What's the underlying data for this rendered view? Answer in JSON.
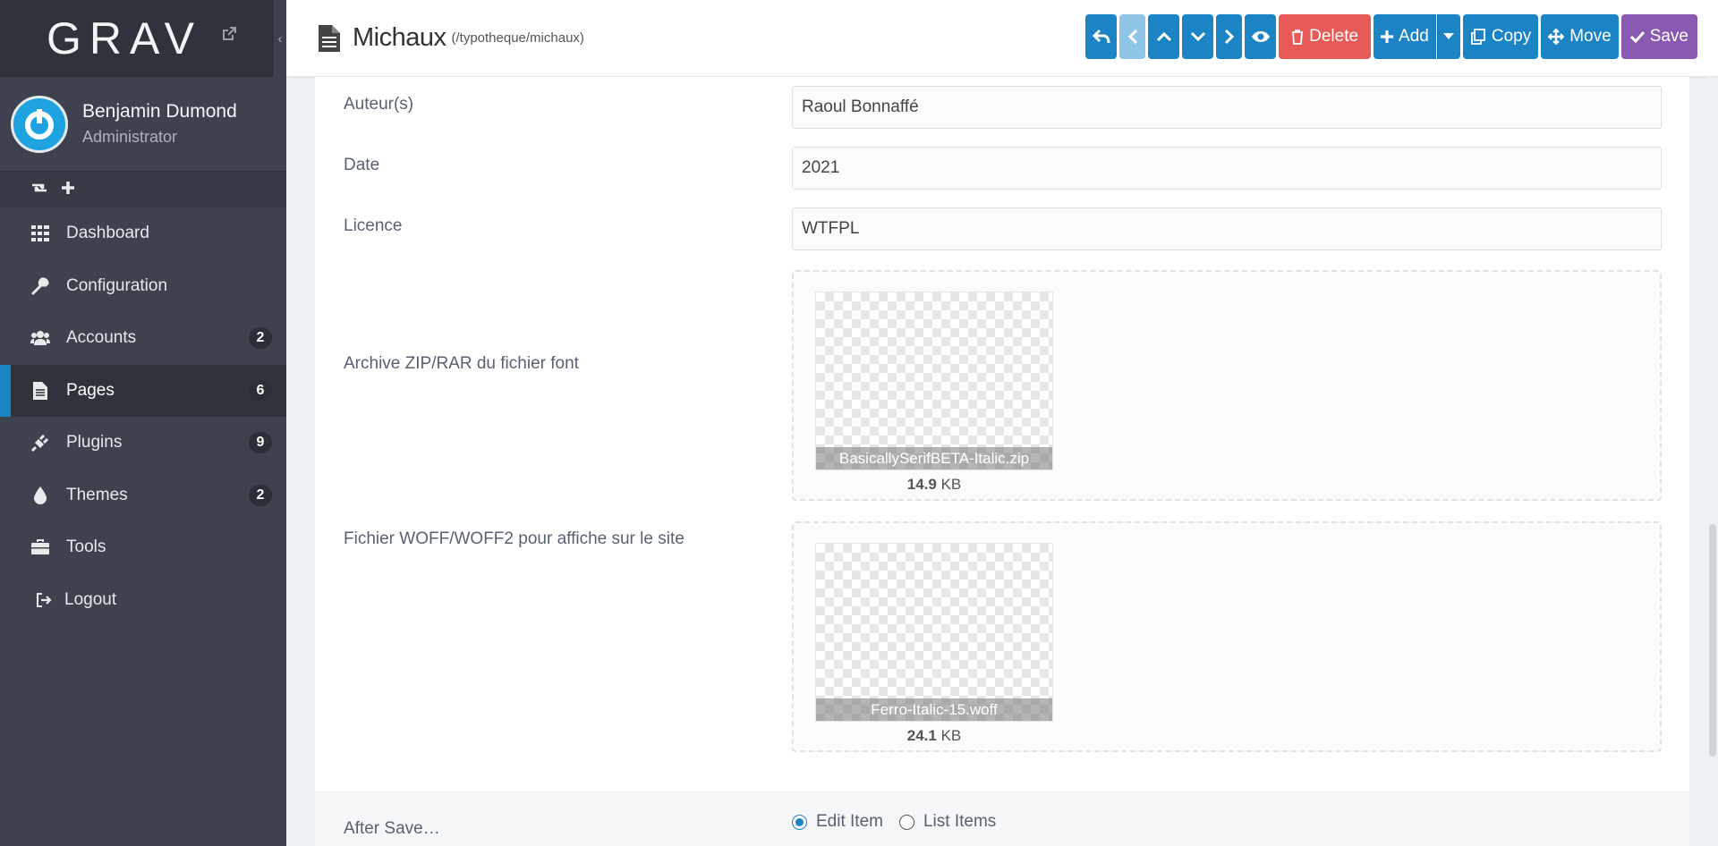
{
  "brand": {
    "logo_text": "GRAV"
  },
  "user": {
    "name": "Benjamin Dumond",
    "role": "Administrator"
  },
  "sidebar": {
    "items": [
      {
        "label": "Dashboard",
        "icon": "dashboard-icon",
        "badge": ""
      },
      {
        "label": "Configuration",
        "icon": "wrench-icon",
        "badge": ""
      },
      {
        "label": "Accounts",
        "icon": "users-icon",
        "badge": "2"
      },
      {
        "label": "Pages",
        "icon": "file-icon",
        "badge": "6",
        "active": true
      },
      {
        "label": "Plugins",
        "icon": "plug-icon",
        "badge": "9"
      },
      {
        "label": "Themes",
        "icon": "tint-icon",
        "badge": "2"
      },
      {
        "label": "Tools",
        "icon": "briefcase-icon",
        "badge": ""
      },
      {
        "label": "Logout",
        "icon": "sign-out-icon",
        "badge": ""
      }
    ]
  },
  "header": {
    "title": "Michaux",
    "route": "(/typotheque/michaux)"
  },
  "toolbar": {
    "delete_label": "Delete",
    "add_label": "Add",
    "copy_label": "Copy",
    "move_label": "Move",
    "save_label": "Save"
  },
  "form": {
    "author_label": "Auteur(s)",
    "author_value": "Raoul Bonnaffé",
    "date_label": "Date",
    "date_value": "2021",
    "license_label": "Licence",
    "license_value": "WTFPL",
    "archive_label": "Archive ZIP/RAR du fichier font",
    "archive_file": {
      "name": "BasicallySerifBETA-Italic.zip",
      "size_value": "14.9",
      "size_unit": "KB"
    },
    "woff_label": "Fichier WOFF/WOFF2 pour affiche sur le site",
    "woff_file": {
      "name": "Ferro-Italic-15.woff",
      "size_value": "24.1",
      "size_unit": "KB"
    }
  },
  "after_save": {
    "label": "After Save…",
    "options": [
      {
        "label": "Edit Item",
        "selected": true
      },
      {
        "label": "List Items",
        "selected": false
      }
    ]
  },
  "colors": {
    "sidebar_bg": "#3d424e",
    "accent_blue": "#1b84c5",
    "danger_red": "#e75a57",
    "save_purple": "#8a5ab3"
  }
}
